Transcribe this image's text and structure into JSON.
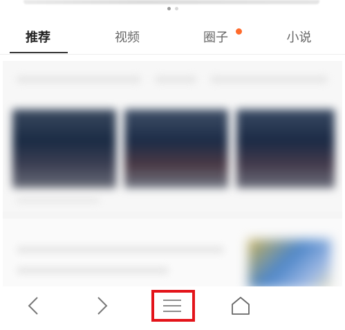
{
  "carousel": {
    "dots": 2,
    "active_dot": 0
  },
  "tabs": [
    {
      "label": "推荐",
      "selected": true,
      "badge": false
    },
    {
      "label": "视频",
      "selected": false,
      "badge": false
    },
    {
      "label": "圈子",
      "selected": false,
      "badge": true
    },
    {
      "label": "小说",
      "selected": false,
      "badge": false
    }
  ],
  "colors": {
    "badge": "#ff6a2b",
    "highlight": "#e3141a",
    "active_tab": "#222222",
    "inactive_tab": "#666666"
  },
  "bottom_nav": [
    {
      "name": "back",
      "icon": "chevron-left-icon"
    },
    {
      "name": "forward",
      "icon": "chevron-right-icon"
    },
    {
      "name": "menu",
      "icon": "menu-icon"
    },
    {
      "name": "home",
      "icon": "home-icon"
    }
  ]
}
